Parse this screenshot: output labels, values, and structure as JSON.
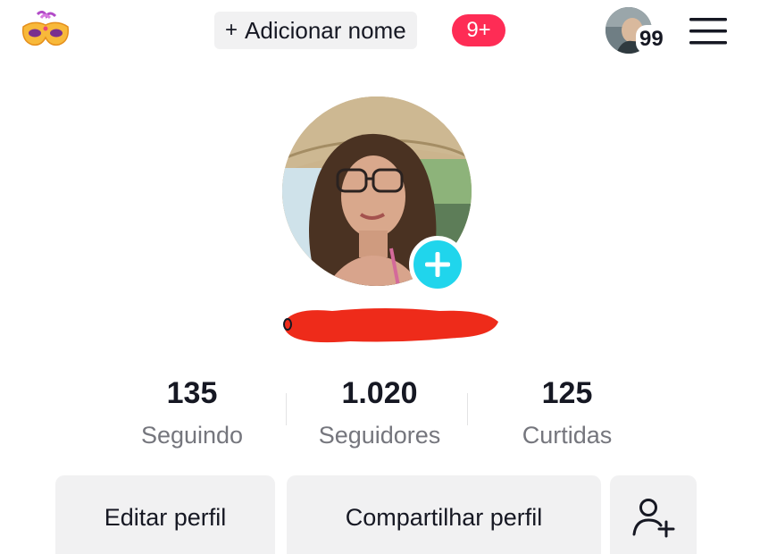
{
  "header": {
    "add_name_plus": "+",
    "add_name_label": "Adicionar nome",
    "notification_badge": "9+",
    "story_count": "99"
  },
  "profile": {
    "username": ""
  },
  "stats": [
    {
      "value": "135",
      "label": "Seguindo"
    },
    {
      "value": "1.020",
      "label": "Seguidores"
    },
    {
      "value": "125",
      "label": "Curtidas"
    }
  ],
  "buttons": {
    "edit_profile": "Editar perfil",
    "share_profile": "Compartilhar perfil"
  },
  "colors": {
    "accent_cyan": "#20d5ec",
    "badge_red": "#fe2c55",
    "redaction_red": "#ee2b1a"
  },
  "icons": [
    "party-mask-icon",
    "plus-icon",
    "hamburger-menu-icon",
    "add-photo-plus-icon",
    "add-friend-icon"
  ]
}
